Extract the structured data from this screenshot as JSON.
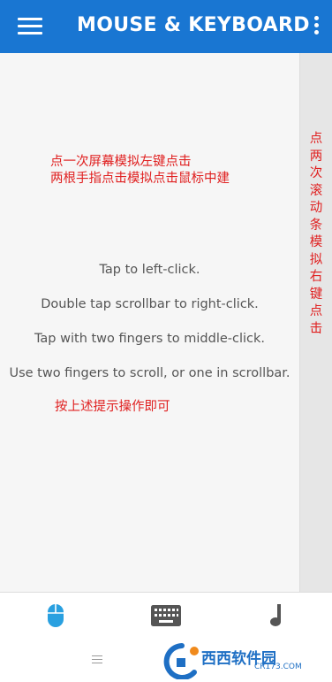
{
  "app_bar": {
    "title": "MOUSE & KEYBOARD",
    "menu_icon": "hamburger-menu-icon",
    "overflow_icon": "more-vert-icon",
    "color": "#1976d2"
  },
  "touchpad": {
    "instructions": [
      "Tap to left-click.",
      "Double tap scrollbar to right-click.",
      "Tap with two fingers to middle-click.",
      "Use two fingers to scroll, or one in scrollbar."
    ],
    "annotations": {
      "top_line1": "点一次屏幕模拟左键点击",
      "top_line2": "两根手指点击模拟点击鼠标中建",
      "bottom": "按上述提示操作即可",
      "scrollbar_vertical": "点两次滚动条模拟右键点击"
    },
    "annotation_color": "#e02020"
  },
  "tabs": [
    {
      "name": "mouse",
      "icon": "mouse-icon",
      "active": true,
      "color": "#29a0e0"
    },
    {
      "name": "keyboard",
      "icon": "keyboard-icon",
      "active": false,
      "color": "#555555"
    },
    {
      "name": "media",
      "icon": "music-note-icon",
      "active": false,
      "color": "#555555"
    }
  ],
  "system_nav": {
    "menu_icon": "menu-lines-icon"
  },
  "watermark": {
    "brand": "西西软件园",
    "url": "CR173.COM"
  }
}
